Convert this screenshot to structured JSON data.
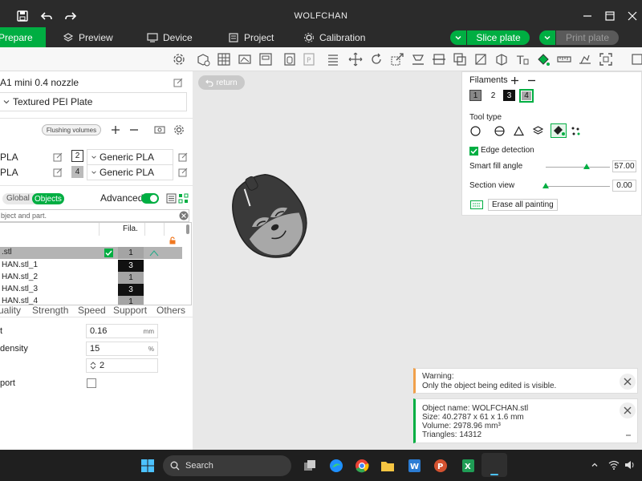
{
  "app": {
    "title": "WOLFCHAN"
  },
  "menu": {
    "tabs": [
      {
        "label": "Prepare",
        "icon": "prepare-icon"
      },
      {
        "label": "Preview",
        "icon": "layers-icon"
      },
      {
        "label": "Device",
        "icon": "device-icon"
      },
      {
        "label": "Project",
        "icon": "project-icon"
      },
      {
        "label": "Calibration",
        "icon": "calibration-icon"
      }
    ],
    "slice_label": "Slice plate",
    "print_label": "Print plate"
  },
  "left": {
    "printer": "A1 mini 0.4 nozzle",
    "plate": "Textured PEI Plate",
    "flushing_label": "Flushing volumes",
    "filaments": [
      {
        "type": "PLA",
        "num": "2",
        "name": "Generic PLA"
      },
      {
        "type": "PLA",
        "num": "4",
        "name": "Generic PLA"
      }
    ],
    "mode_global": "Global",
    "mode_objects": "Objects",
    "advanced_label": "Advanced",
    "search_placeholder": "bject and part.",
    "list_header_fila": "Fila.",
    "objects": [
      {
        "name": ".stl",
        "fila": "1"
      },
      {
        "name": "HAN.stl_1",
        "fila": "3"
      },
      {
        "name": "HAN.stl_2",
        "fila": "1"
      },
      {
        "name": "HAN.stl_3",
        "fila": "3"
      },
      {
        "name": "HAN.stl_4",
        "fila": "1"
      }
    ],
    "setting_tabs": [
      "uality",
      "Strength",
      "Speed",
      "Support",
      "Others"
    ],
    "params": [
      {
        "label": "t",
        "value": "0.16",
        "unit": "mm"
      },
      {
        "label": " density",
        "value": "15",
        "unit": "%"
      },
      {
        "label": "",
        "value": "2",
        "unit": ""
      }
    ],
    "support_label": "port"
  },
  "viewport": {
    "return_label": "return"
  },
  "paint": {
    "filaments_label": "Filaments",
    "slots": [
      "1",
      "2",
      "3",
      "4"
    ],
    "tooltype_label": "Tool type",
    "edge_label": "Edge detection",
    "smart_label": "Smart fill angle",
    "smart_value": "57.00",
    "section_label": "Section view",
    "section_value": "0.00",
    "erase_label": "Erase all painting"
  },
  "notices": {
    "warning_title": "Warning:",
    "warning_text": "Only the object being edited is visible.",
    "obj_name": "Object name: WOLFCHAN.stl",
    "obj_size": "Size: 40.2787 x 61 x 1.6 mm",
    "obj_volume": "Volume: 2978.96 mm³",
    "obj_tris": "Triangles: 14312"
  },
  "taskbar": {
    "search_label": "Search"
  },
  "colors": {
    "accent": "#00ae42",
    "titlebar": "#2b2b2b",
    "warning": "#f0a04b"
  }
}
